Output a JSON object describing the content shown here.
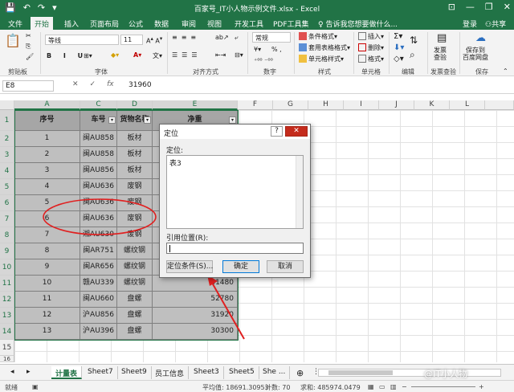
{
  "window": {
    "title": "百家号_IT小人物示例文件.xlsx - Excel",
    "qat": [
      "💾",
      "↶",
      "↷",
      "▾"
    ]
  },
  "ribbon_tabs": [
    "文件",
    "开始",
    "插入",
    "页面布局",
    "公式",
    "数据",
    "审阅",
    "视图",
    "开发工具",
    "PDF工具集"
  ],
  "ribbon_tabs_active": "开始",
  "tell_me": "告诉我您想要做什么...",
  "sign_in": "登录",
  "share": "共享",
  "ribbon": {
    "font_name": "等线",
    "font_size": "11",
    "font_style": "B I U",
    "number_format": "常规",
    "number_symbols": "% ,",
    "groups": [
      "剪贴板",
      "字体",
      "对齐方式",
      "数字",
      "样式",
      "单元格",
      "编辑",
      "发票查验",
      "保存"
    ],
    "style_items": [
      "条件格式",
      "套用表格格式",
      "单元格样式"
    ],
    "cell_items": [
      "插入",
      "删除",
      "格式"
    ],
    "invoice_btn": "发票\n查验",
    "save_btn": "保存到\n百度网盘"
  },
  "formula_bar": {
    "name_box": "E8",
    "fx": "fx",
    "value": "31960"
  },
  "columns": [
    "A",
    "C",
    "D",
    "E",
    "F",
    "G",
    "H",
    "I",
    "J",
    "K",
    "L"
  ],
  "rows": [
    "1",
    "2",
    "3",
    "4",
    "5",
    "6",
    "7",
    "8",
    "9",
    "10",
    "11",
    "12",
    "13",
    "14",
    "15",
    "16"
  ],
  "table": {
    "headers": [
      "序号",
      "车号",
      "货物名称",
      "净重"
    ],
    "rows": [
      [
        "1",
        "闽AU858",
        "板材",
        ""
      ],
      [
        "2",
        "闽AU858",
        "板材",
        ""
      ],
      [
        "3",
        "闽AU856",
        "板材",
        ""
      ],
      [
        "4",
        "闽AU636",
        "废钢",
        ""
      ],
      [
        "5",
        "闽AU636",
        "废钢",
        ""
      ],
      [
        "6",
        "闽AU636",
        "废钢",
        ""
      ],
      [
        "7",
        "湘AU630",
        "废钢",
        ""
      ],
      [
        "8",
        "闽AR751",
        "螺纹钢",
        ""
      ],
      [
        "9",
        "闽AR656",
        "螺纹钢",
        ""
      ],
      [
        "10",
        "赣AU339",
        "螺纹钢",
        "31480"
      ],
      [
        "11",
        "闽AU660",
        "盘螺",
        "52780"
      ],
      [
        "12",
        "沪AU856",
        "盘螺",
        "31920"
      ],
      [
        "13",
        "沪AU396",
        "盘螺",
        "30300"
      ]
    ]
  },
  "dialog": {
    "title": "定位",
    "help": "?",
    "close": "✕",
    "goto_label": "定位:",
    "list_item": "表3",
    "ref_label": "引用位置(R):",
    "special_btn": "定位条件(S)...",
    "ok_btn": "确定",
    "cancel_btn": "取消"
  },
  "sheet_tabs": [
    "计量表",
    "Sheet7",
    "Sheet9",
    "员工信息",
    "Sheet3",
    "Sheet5",
    "She ..."
  ],
  "status_bar": {
    "ready": "就绪",
    "average": "平均值: 18691.30953",
    "count": "计数: 70",
    "sum": "求和: 485974.0479"
  },
  "watermark": "@IT小人物",
  "colors": {
    "excel_green": "#217346",
    "annotation_red": "#e02020",
    "selection_gray": "#bfbfbf"
  }
}
